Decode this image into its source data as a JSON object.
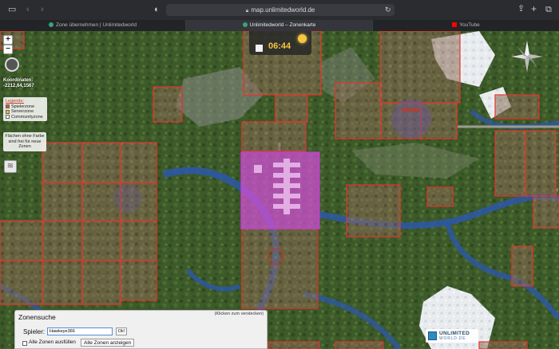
{
  "browser": {
    "url": "map.unlimitedworld.de",
    "tabs": [
      {
        "label": "Zone übernehmen | Unlimitedworld",
        "active": false,
        "favicon_color": "#3aa37a"
      },
      {
        "label": "Unlimitedworld – Zonenkarte",
        "active": true,
        "favicon_color": "#3aa37a"
      },
      {
        "label": "YouTube",
        "active": false,
        "favicon_color": "#ff0000"
      }
    ]
  },
  "map": {
    "zoom_in": "+",
    "zoom_out": "−",
    "coordinates_label": "Koordinaten:",
    "coordinates_value": "-2212,64,1567",
    "legend": {
      "title": "Legende:",
      "items": [
        {
          "label": "Spielerzone",
          "color": "#e74c3c"
        },
        {
          "label": "Serverzone",
          "color": "#f1c40f"
        },
        {
          "label": "Communityzone",
          "color": "#ffffff"
        }
      ]
    },
    "free_note": "Flächen ohne Farbe sind frei für neue Zonen",
    "clock_time": "06:44"
  },
  "zone_search": {
    "title": "Zonensuche",
    "hide_hint": "(Klicken zum verstecken)",
    "player_label": "Spieler:",
    "player_value": "Hawkeye366",
    "ok_label": "Ok!",
    "fill_all_label": "Alle Zonen ausfüllen",
    "show_all_label": "Alle Zonen anzeigen"
  },
  "logo": {
    "line1": "UNLIMITED",
    "line2": "WORLD.DE"
  }
}
